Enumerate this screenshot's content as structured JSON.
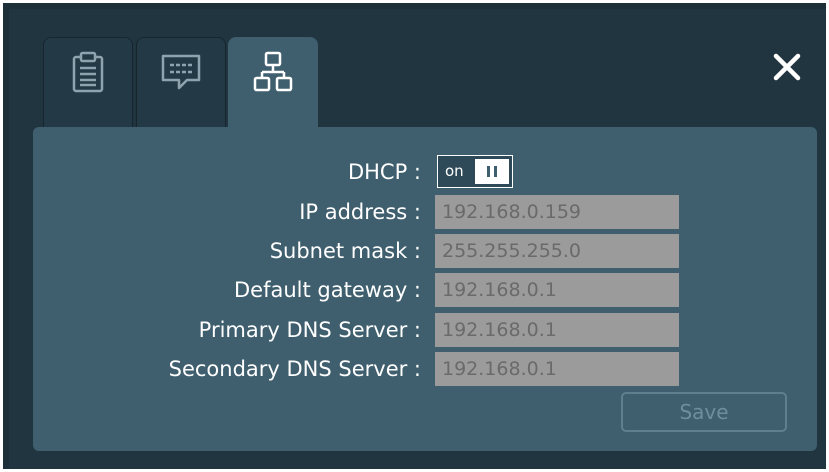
{
  "tabs": [
    {
      "icon": "clipboard-icon",
      "active": false
    },
    {
      "icon": "chat-bubble-icon",
      "active": false
    },
    {
      "icon": "network-icon",
      "active": true
    }
  ],
  "close": {
    "icon": "close-icon"
  },
  "network": {
    "dhcp": {
      "label": "DHCP :",
      "state_text": "on",
      "value": true
    },
    "fields": [
      {
        "label": "IP address :",
        "value": "192.168.0.159"
      },
      {
        "label": "Subnet mask :",
        "value": "255.255.255.0"
      },
      {
        "label": "Default gateway :",
        "value": "192.168.0.1"
      },
      {
        "label": "Primary DNS Server :",
        "value": "192.168.0.1"
      },
      {
        "label": "Secondary DNS Server :",
        "value": "192.168.0.1"
      }
    ],
    "save_label": "Save"
  },
  "colors": {
    "background": "#1d2f38",
    "panel": "#3f5f6f",
    "field_bg": "#9b9b9b",
    "field_text": "#6a6a6a"
  }
}
